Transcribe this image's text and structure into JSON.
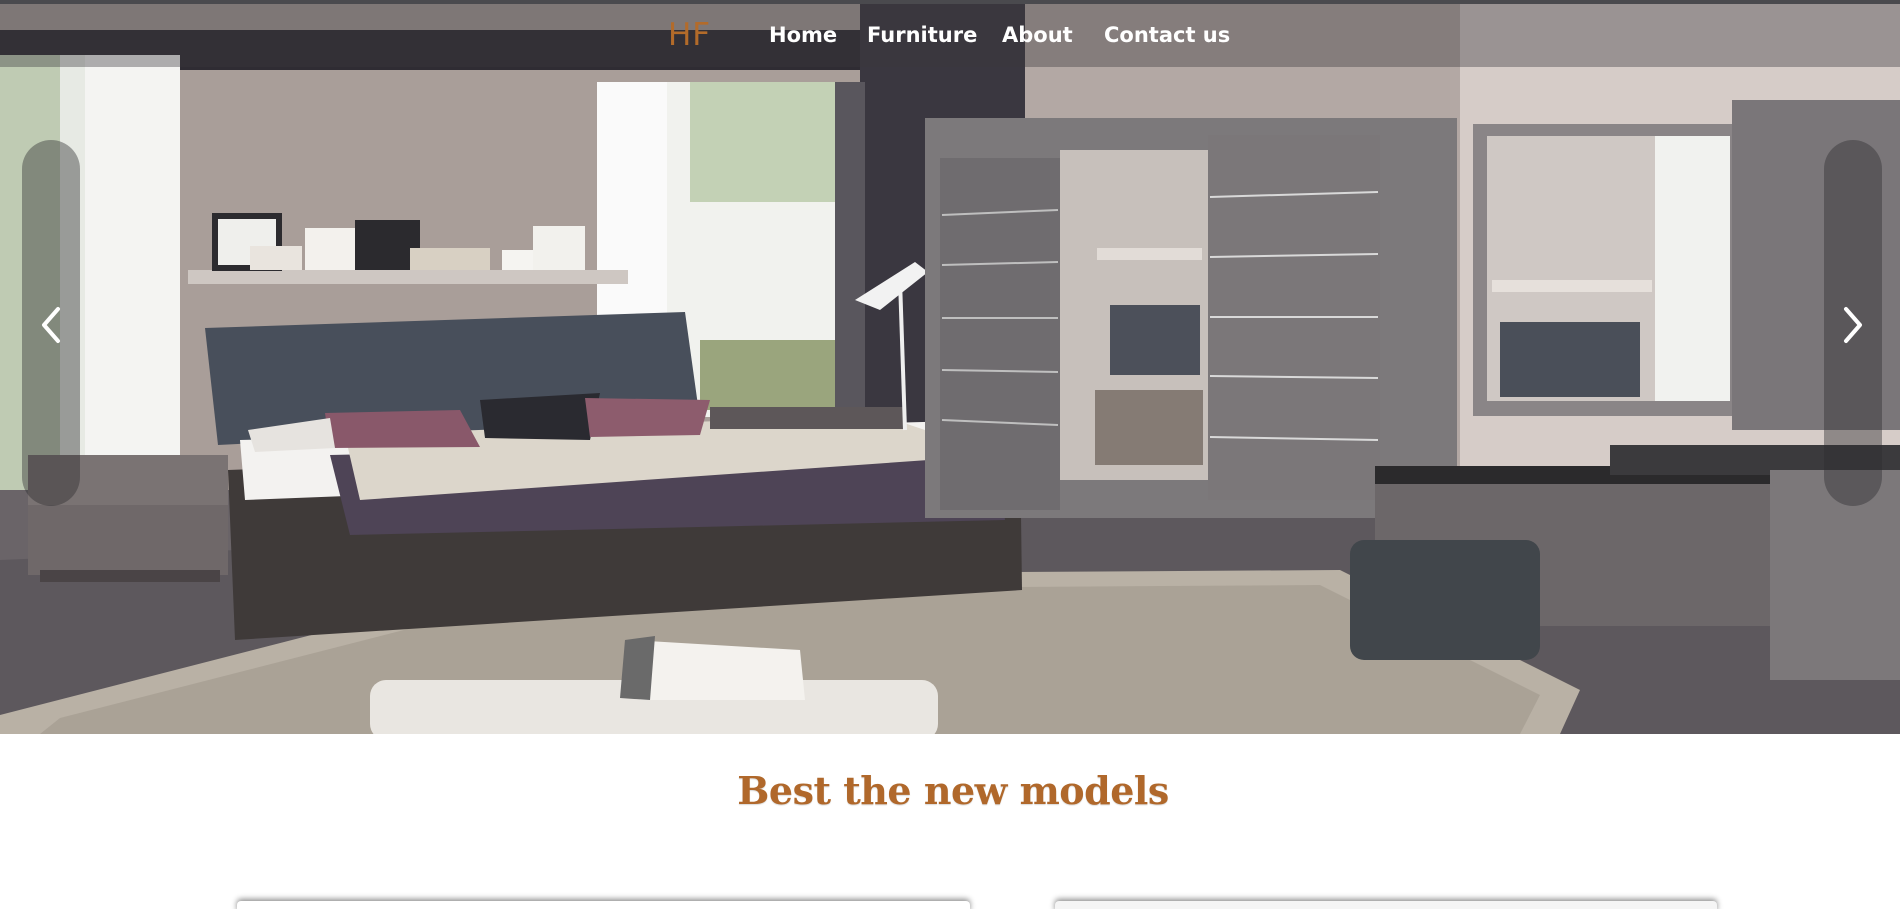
{
  "navbar": {
    "brand": "HF",
    "links": [
      {
        "label": "Home"
      },
      {
        "label": "Furniture"
      },
      {
        "label": "About"
      },
      {
        "label": "Contact us"
      }
    ]
  },
  "slider": {
    "prev_icon": "chevron-left-icon",
    "next_icon": "chevron-right-icon"
  },
  "section": {
    "title": "Best the new models"
  },
  "colors": {
    "brand_accent": "#b36b2a",
    "title_color": "#b0682b",
    "nav_text": "#ffffff"
  }
}
